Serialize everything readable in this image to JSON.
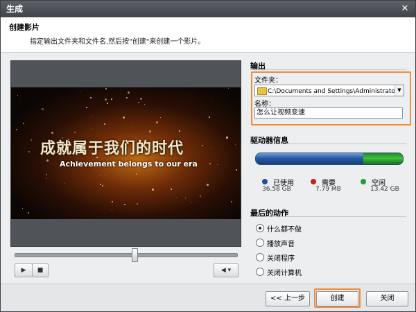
{
  "window": {
    "title": "生成",
    "close_glyph": "✕"
  },
  "header": {
    "title": "创建影片",
    "description": "指定输出文件夹和文件名,然后按\"创建\"来创建一个影片。"
  },
  "preview": {
    "title_text": "成就属于我们的时代",
    "subtitle_text": "Achievement belongs to our era",
    "seek_position": 0.54
  },
  "playback": {
    "play_icon": "play-icon",
    "stop_icon": "stop-icon",
    "volume_icon": "speaker-icon"
  },
  "output": {
    "section_title": "输出",
    "folder_label": "文件夹：",
    "folder_value": "C:\\Documents and Settings\\Administrator\\桌面",
    "name_label": "名称：",
    "name_value": "怎么让视频变速"
  },
  "drive": {
    "section_title": "驱动器信息",
    "used_fraction": 0.73,
    "items": [
      {
        "label": "已使用",
        "value": "36.58 GB",
        "color": "#1f4fa8"
      },
      {
        "label": "需要",
        "value": "7.79 MB",
        "color": "#c0201e"
      },
      {
        "label": "空闲",
        "value": "13.42 GB",
        "color": "#239b34"
      }
    ]
  },
  "final_action": {
    "section_title": "最后的动作",
    "options": [
      {
        "label": "什么都不做",
        "selected": true
      },
      {
        "label": "播放声音",
        "selected": false
      },
      {
        "label": "关闭程序",
        "selected": false
      },
      {
        "label": "关闭计算机",
        "selected": false
      }
    ]
  },
  "buttons": {
    "back": "<< 上一步",
    "create": "创建",
    "close": "关闭"
  },
  "colors": {
    "highlight": "#ef8a3e",
    "titlebar": "#4a4e54"
  }
}
